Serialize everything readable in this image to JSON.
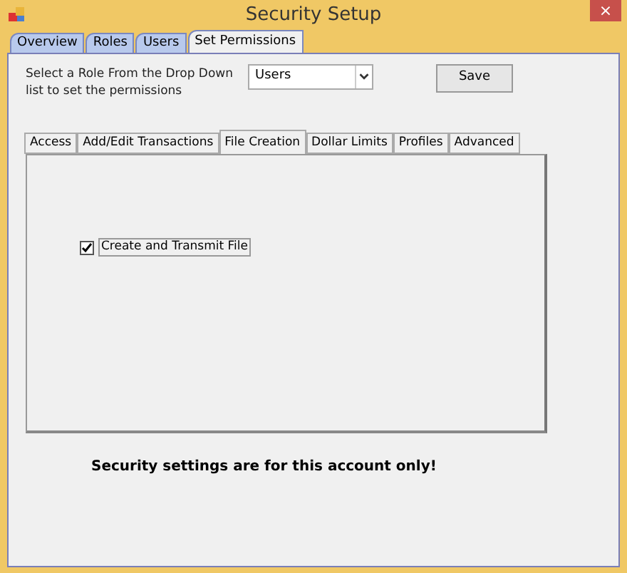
{
  "window": {
    "title": "Security Setup",
    "close": "×"
  },
  "tabs": [
    {
      "label": "Overview",
      "selected": false
    },
    {
      "label": "Roles",
      "selected": false
    },
    {
      "label": "Users",
      "selected": false
    },
    {
      "label": "Set Permissions",
      "selected": true
    }
  ],
  "role_prompt": "Select a Role From the Drop Down list to set the permissions",
  "role_dropdown": {
    "value": "Users"
  },
  "save_button": "Save",
  "permission_tabs": [
    {
      "label": "Access",
      "selected": false
    },
    {
      "label": "Add/Edit Transactions",
      "selected": false
    },
    {
      "label": "File Creation",
      "selected": true
    },
    {
      "label": "Dollar Limits",
      "selected": false
    },
    {
      "label": "Profiles",
      "selected": false
    },
    {
      "label": "Advanced",
      "selected": false
    }
  ],
  "options": [
    {
      "label": "Create and Transmit File",
      "checked": true
    }
  ],
  "notice": "Security settings are for this account only!"
}
